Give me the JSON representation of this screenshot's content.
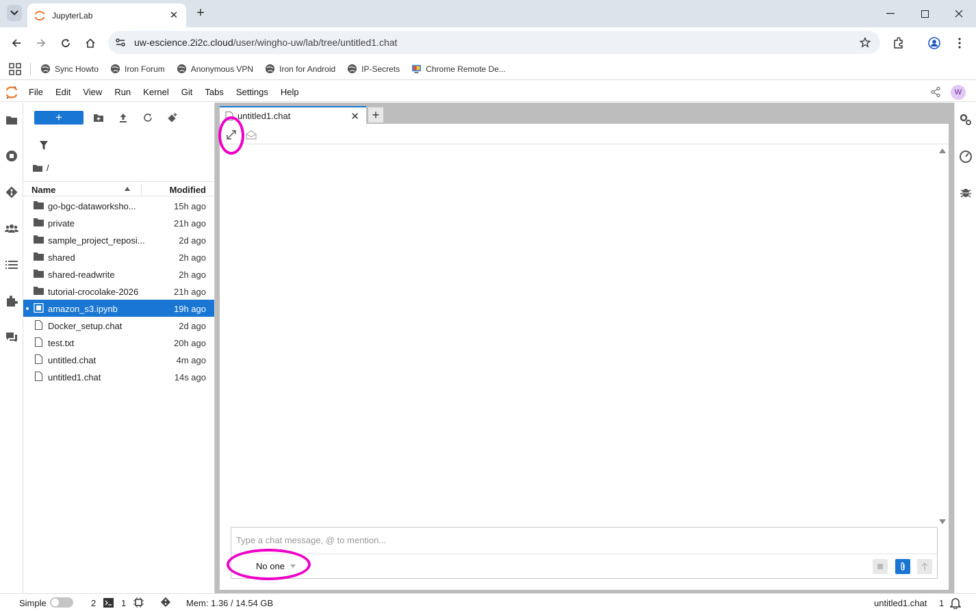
{
  "browser": {
    "tab_title": "JupyterLab",
    "url_host": "uw-escience.2i2c.cloud",
    "url_path": "/user/wingho-uw/lab/tree/untitled1.chat",
    "bookmarks": [
      {
        "label": "Sync Howto"
      },
      {
        "label": "Iron Forum"
      },
      {
        "label": "Anonymous VPN"
      },
      {
        "label": "Iron for Android"
      },
      {
        "label": "IP-Secrets"
      },
      {
        "label": "Chrome Remote De..."
      }
    ]
  },
  "jupyter": {
    "menu": [
      "File",
      "Edit",
      "View",
      "Run",
      "Kernel",
      "Git",
      "Tabs",
      "Settings",
      "Help"
    ],
    "user_initial": "W",
    "new_label": "+",
    "breadcrumb": "/",
    "columns": {
      "name": "Name",
      "modified": "Modified"
    },
    "files": [
      {
        "name": "go-bgc-dataworksho...",
        "modified": "15h ago",
        "type": "folder",
        "selected": false
      },
      {
        "name": "private",
        "modified": "21h ago",
        "type": "folder",
        "selected": false
      },
      {
        "name": "sample_project_reposi...",
        "modified": "2d ago",
        "type": "folder",
        "selected": false
      },
      {
        "name": "shared",
        "modified": "2h ago",
        "type": "folder",
        "selected": false
      },
      {
        "name": "shared-readwrite",
        "modified": "2h ago",
        "type": "folder",
        "selected": false
      },
      {
        "name": "tutorial-crocolake-2026",
        "modified": "21h ago",
        "type": "folder",
        "selected": false
      },
      {
        "name": "amazon_s3.ipynb",
        "modified": "19h ago",
        "type": "notebook",
        "selected": true
      },
      {
        "name": "Docker_setup.chat",
        "modified": "2d ago",
        "type": "file",
        "selected": false
      },
      {
        "name": "test.txt",
        "modified": "20h ago",
        "type": "file",
        "selected": false
      },
      {
        "name": "untitled.chat",
        "modified": "4m ago",
        "type": "file",
        "selected": false
      },
      {
        "name": "untitled1.chat",
        "modified": "14s ago",
        "type": "file",
        "selected": false
      }
    ],
    "doc_tab": "untitled1.chat",
    "chat": {
      "placeholder": "Type a chat message, @ to mention...",
      "send_to": "No one"
    },
    "status": {
      "mode": "Simple",
      "terminals": "2",
      "kernels": "1",
      "memory": "Mem: 1.36 / 14.54 GB",
      "current_file": "untitled1.chat",
      "notifications": "1"
    },
    "colors": {
      "accent": "#1976d2",
      "highlight": "#ee00c8"
    }
  }
}
